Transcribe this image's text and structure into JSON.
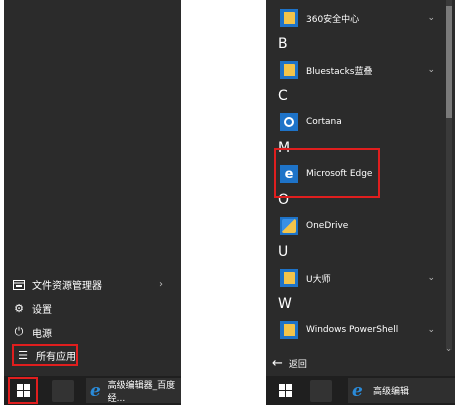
{
  "left_menu": {
    "items": [
      {
        "label": "文件资源管理器",
        "icon": "file-explorer-icon",
        "has_chevron": true
      },
      {
        "label": "设置",
        "icon": "gear-icon",
        "has_chevron": false
      },
      {
        "label": "电源",
        "icon": "power-icon",
        "has_chevron": false
      },
      {
        "label": "所有应用",
        "icon": "list-icon",
        "has_chevron": false
      }
    ],
    "chevron": "›"
  },
  "taskbar_left": {
    "task_label": "高级编辑器_百度经..."
  },
  "app_list": {
    "rows": [
      {
        "kind": "app",
        "label": "360安全中心",
        "icon": "folder-icon",
        "chevron": "⌄"
      },
      {
        "kind": "letter",
        "label": "B"
      },
      {
        "kind": "app",
        "label": "Bluestacks蓝叠",
        "icon": "folder-icon",
        "chevron": "⌄"
      },
      {
        "kind": "letter",
        "label": "C"
      },
      {
        "kind": "app",
        "label": "Cortana",
        "icon": "cortana-icon"
      },
      {
        "kind": "letter",
        "label": "M"
      },
      {
        "kind": "app",
        "label": "Microsoft Edge",
        "icon": "edge-icon"
      },
      {
        "kind": "letter",
        "label": "O"
      },
      {
        "kind": "app",
        "label": "OneDrive",
        "icon": "onedrive-icon"
      },
      {
        "kind": "letter",
        "label": "U"
      },
      {
        "kind": "app",
        "label": "U大师",
        "icon": "folder-icon",
        "chevron": "⌄"
      },
      {
        "kind": "letter",
        "label": "W"
      },
      {
        "kind": "app",
        "label": "Windows PowerShell",
        "icon": "folder-icon",
        "chevron": "⌄"
      }
    ],
    "back_label": "返回"
  },
  "taskbar_right": {
    "task_label": "高级编辑"
  },
  "colors": {
    "highlight": "#e01e1e",
    "tile_blue": "#1e73c8",
    "folder_yellow": "#f3c44a",
    "panel_bg": "#2b2b2b"
  }
}
